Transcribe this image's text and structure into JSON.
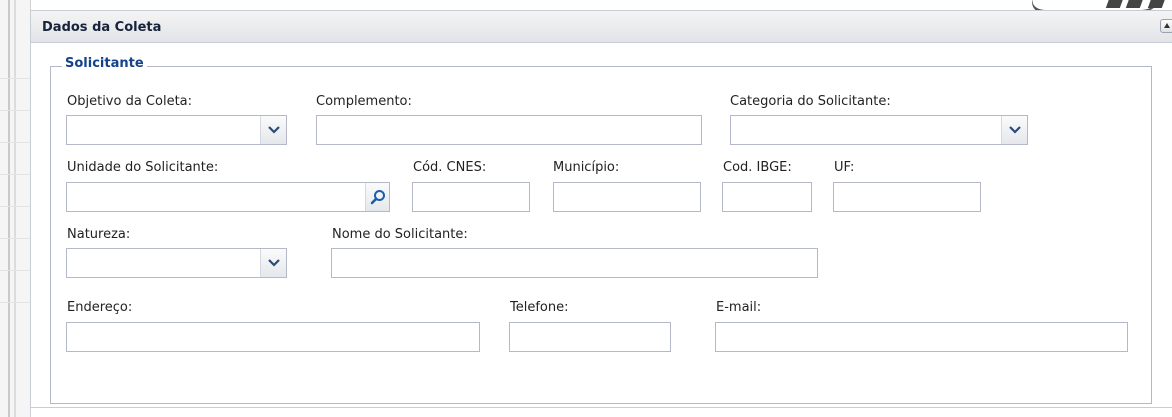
{
  "panel": {
    "title": "Dados da Coleta"
  },
  "section": {
    "legend": "Solicitante"
  },
  "fields": {
    "objetivo": {
      "label": "Objetivo da Coleta:",
      "value": ""
    },
    "complemento": {
      "label": "Complemento:",
      "value": ""
    },
    "categoria": {
      "label": "Categoria do Solicitante:",
      "value": ""
    },
    "unidade": {
      "label": "Unidade do Solicitante:",
      "value": ""
    },
    "cnes": {
      "label": "Cód. CNES:",
      "value": ""
    },
    "municipio": {
      "label": "Município:",
      "value": ""
    },
    "ibge": {
      "label": "Cod. IBGE:",
      "value": ""
    },
    "uf": {
      "label": "UF:",
      "value": ""
    },
    "natureza": {
      "label": "Natureza:",
      "value": ""
    },
    "nome": {
      "label": "Nome do Solicitante:",
      "value": ""
    },
    "endereco": {
      "label": "Endereço:",
      "value": ""
    },
    "telefone": {
      "label": "Telefone:",
      "value": ""
    },
    "email": {
      "label": "E-mail:",
      "value": ""
    }
  },
  "icons": {
    "dropdown": "chevron-down-icon",
    "lookup": "search-icon",
    "collapse": "collapse-up-icon"
  },
  "colors": {
    "title": "#15233b",
    "legend": "#15428b",
    "border": "#b5b8c8",
    "search_icon": "#1a5eb0"
  }
}
